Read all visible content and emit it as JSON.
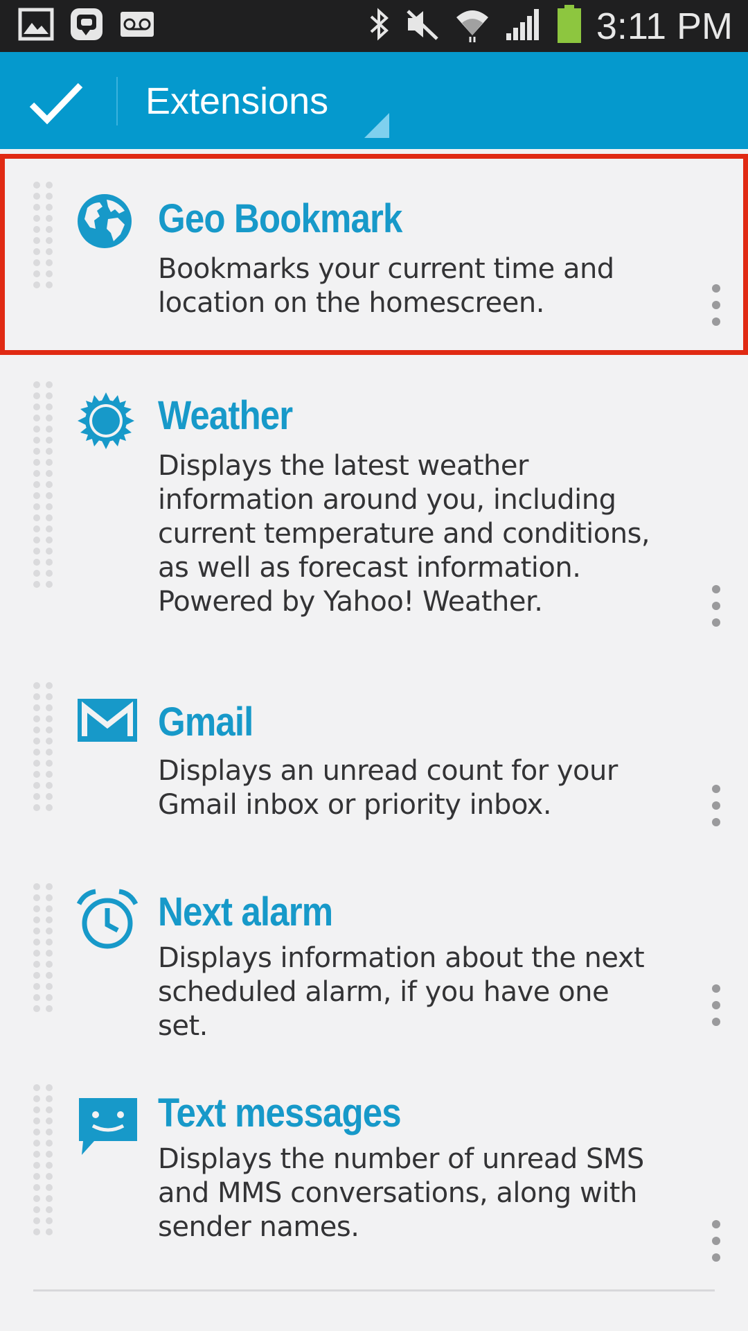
{
  "status_bar": {
    "left_icons": [
      "gallery-icon",
      "messenger-icon",
      "voicemail-icon"
    ],
    "right_icons": [
      "bluetooth-icon",
      "mute-icon",
      "wifi-icon",
      "signal-icon",
      "battery-icon"
    ],
    "time": "3:11 PM"
  },
  "action_bar": {
    "confirm_icon": "check-icon",
    "title": "Extensions",
    "background": "#0599cd"
  },
  "extensions": [
    {
      "title": "Geo Bookmark",
      "description": "Bookmarks your current time and location on the homescreen.",
      "icon": "globe-icon",
      "selected": true
    },
    {
      "title": "Weather",
      "description": "Displays the latest weather information around you, including current temperature and conditions, as well as forecast information. Powered by Yahoo! Weather.",
      "icon": "sun-icon",
      "selected": false
    },
    {
      "title": "Gmail",
      "description": "Displays an unread count for your Gmail inbox or priority inbox.",
      "icon": "gmail-icon",
      "selected": false
    },
    {
      "title": "Next alarm",
      "description": "Displays information about the next scheduled alarm, if you have one set.",
      "icon": "alarm-clock-icon",
      "selected": false
    },
    {
      "title": "Text messages",
      "description": "Displays the number of unread SMS and MMS conversations, along with sender names.",
      "icon": "chat-bubble-icon",
      "selected": false
    }
  ],
  "colors": {
    "accent": "#1799c9",
    "selection": "#e02a13",
    "background": "#f2f2f3"
  }
}
